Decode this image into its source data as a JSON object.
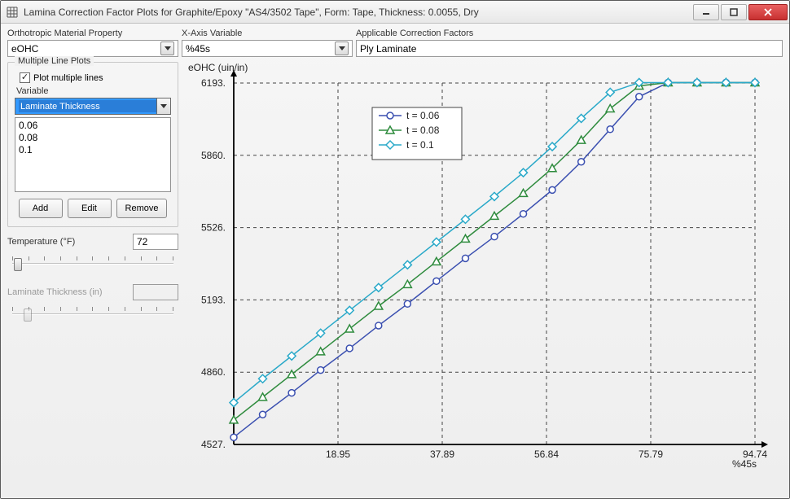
{
  "window": {
    "title": "Lamina Correction Factor Plots for Graphite/Epoxy \"AS4/3502 Tape\", Form: Tape, Thickness: 0.0055, Dry"
  },
  "labels": {
    "ortho_prop": "Orthotropic Material Property",
    "xaxis_var": "X-Axis Variable",
    "appl_cf": "Applicable Correction Factors",
    "multiple_line_plots": "Multiple Line Plots",
    "plot_multi": "Plot multiple lines",
    "variable": "Variable",
    "add": "Add",
    "edit": "Edit",
    "remove": "Remove",
    "temperature": "Temperature (°F)",
    "lam_thickness": "Laminate Thickness (in)"
  },
  "dropdowns": {
    "ortho_prop_value": "eOHC",
    "xaxis_var_value": "%45s",
    "appl_cf_value": "Ply Laminate",
    "variable_value": "Laminate Thickness"
  },
  "list_values": [
    "0.06",
    "0.08",
    "0.1"
  ],
  "temperature_value": "72",
  "thickness_value": "",
  "chart": {
    "ylabel": "eOHC (uin/in)",
    "xlabel": "%45s",
    "y_ticks": [
      "4527.",
      "4860.",
      "5193.",
      "5526.",
      "5860.",
      "6193."
    ],
    "x_ticks": [
      "18.95",
      "37.89",
      "56.84",
      "75.79",
      "94.74"
    ],
    "legend": [
      "t = 0.06",
      "t = 0.08",
      "t = 0.1"
    ]
  },
  "chart_data": {
    "type": "line",
    "title": "",
    "xlabel": "%45s",
    "ylabel": "eOHC (uin/in)",
    "xlim": [
      0,
      94.74
    ],
    "ylim": [
      4527,
      6193
    ],
    "x": [
      0,
      5.26,
      10.53,
      15.79,
      21.05,
      26.32,
      31.58,
      36.84,
      42.11,
      47.37,
      52.63,
      57.89,
      63.16,
      68.42,
      73.68,
      78.95,
      84.21,
      89.47,
      94.74
    ],
    "series": [
      {
        "name": "t = 0.06",
        "color": "#3a4fb0",
        "marker": "circle",
        "values": [
          4560,
          4665,
          4765,
          4870,
          4970,
          5075,
          5175,
          5280,
          5385,
          5485,
          5590,
          5700,
          5830,
          5980,
          6130,
          6195,
          6195,
          6195,
          6195
        ]
      },
      {
        "name": "t = 0.08",
        "color": "#2e8b3d",
        "marker": "triangle",
        "values": [
          4640,
          4745,
          4850,
          4955,
          5060,
          5165,
          5265,
          5370,
          5475,
          5580,
          5685,
          5800,
          5930,
          6075,
          6180,
          6195,
          6195,
          6195,
          6195
        ]
      },
      {
        "name": "t = 0.1",
        "color": "#2aa9c9",
        "marker": "diamond",
        "values": [
          4720,
          4830,
          4935,
          5040,
          5145,
          5250,
          5355,
          5460,
          5565,
          5670,
          5780,
          5900,
          6030,
          6150,
          6195,
          6195,
          6195,
          6195,
          6195
        ]
      }
    ]
  }
}
